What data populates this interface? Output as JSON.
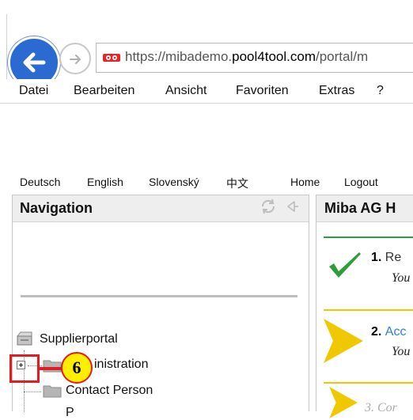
{
  "browser": {
    "url_prefix": "https://",
    "url_host_a": "mibademo.",
    "url_host_b": "pool4tool.com",
    "url_path": "/portal/m",
    "menu": [
      "Datei",
      "Bearbeiten",
      "Ansicht",
      "Favoriten",
      "Extras",
      "?"
    ]
  },
  "page": {
    "languages": [
      "Deutsch",
      "English",
      "Slovenský",
      "中文"
    ],
    "links": [
      "Home",
      "Logout"
    ]
  },
  "navigation": {
    "title": "Navigation",
    "tree": {
      "root": "Supplierportal",
      "administration": "inistration",
      "contact_person": "Contact Person",
      "partial": "P"
    }
  },
  "main": {
    "title": "Miba AG H",
    "steps": [
      {
        "num": "1.",
        "label": "Re",
        "sub": "You",
        "status": "done",
        "color": "#2e9d3a"
      },
      {
        "num": "2.",
        "label": "Acc",
        "sub": "You",
        "status": "active",
        "color": "#f0c800"
      },
      {
        "num": "3.",
        "label": "Cor",
        "sub": "",
        "status": "pending",
        "color": "#f0c800"
      }
    ]
  },
  "callout": {
    "number": "6"
  }
}
